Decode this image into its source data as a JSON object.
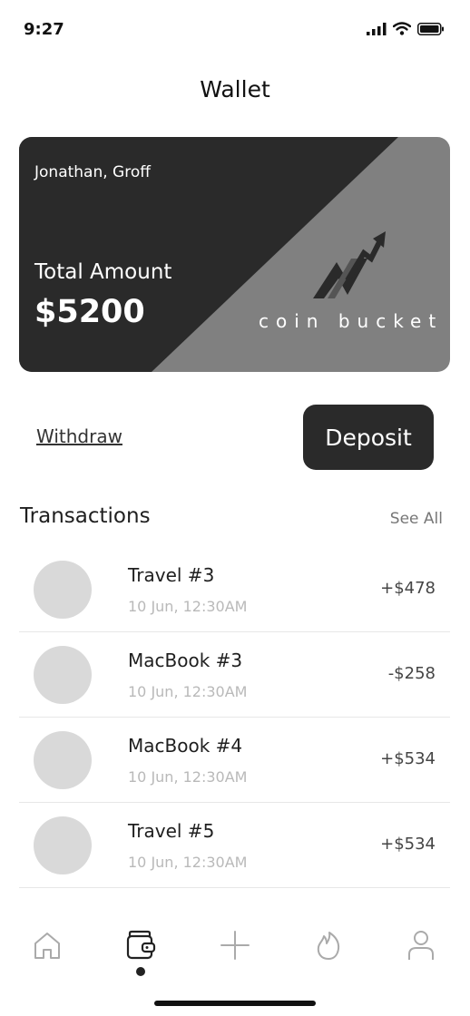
{
  "status_bar": {
    "time": "9:27"
  },
  "header": {
    "title": "Wallet"
  },
  "card": {
    "holder": "Jonathan, Groff",
    "total_label": "Total Amount",
    "total_value": "$5200",
    "brand": "coin bucket",
    "colors": {
      "dark": "#2a2a2a",
      "light": "#808080"
    }
  },
  "actions": {
    "withdraw_label": "Withdraw",
    "deposit_label": "Deposit"
  },
  "transactions": {
    "title": "Transactions",
    "see_all": "See All",
    "items": [
      {
        "name": "Travel #3",
        "date": "10 Jun, 12:30AM",
        "amount": "+$478"
      },
      {
        "name": "MacBook #3",
        "date": "10 Jun, 12:30AM",
        "amount": "-$258"
      },
      {
        "name": "MacBook #4",
        "date": "10 Jun, 12:30AM",
        "amount": "+$534"
      },
      {
        "name": "Travel #5",
        "date": "10 Jun, 12:30AM",
        "amount": "+$534"
      }
    ]
  },
  "bottom_nav": {
    "items": [
      "home-icon",
      "wallet-icon",
      "plus-icon",
      "flame-icon",
      "profile-icon"
    ],
    "active": "wallet-icon"
  }
}
